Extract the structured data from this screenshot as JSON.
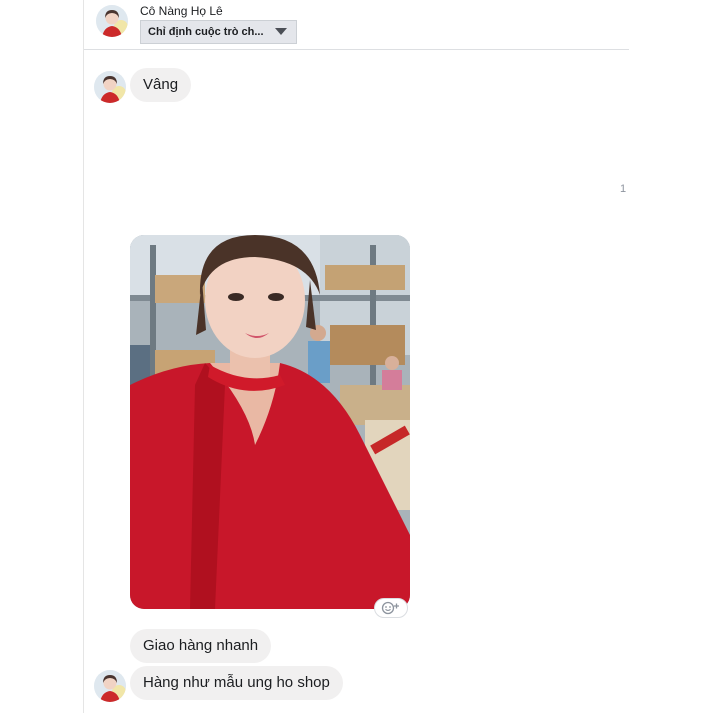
{
  "header": {
    "contact_name": "Cô Nàng Họ Lê",
    "conversation_select": "Chỉ định cuộc trò ch..."
  },
  "messages": [
    {
      "text": "Vâng"
    },
    {
      "text": "Giao hàng nhanh"
    },
    {
      "text": "Hàng như mẫu ung ho shop"
    }
  ],
  "seen_count": "1",
  "icons": {
    "avatar": "avatar-icon",
    "dropdown": "caret-down-icon",
    "reaction": "add-reaction-icon"
  },
  "colors": {
    "bubble_bg": "#f1f0f0",
    "select_bg": "#e4e6eb",
    "text": "#1c1e21"
  }
}
